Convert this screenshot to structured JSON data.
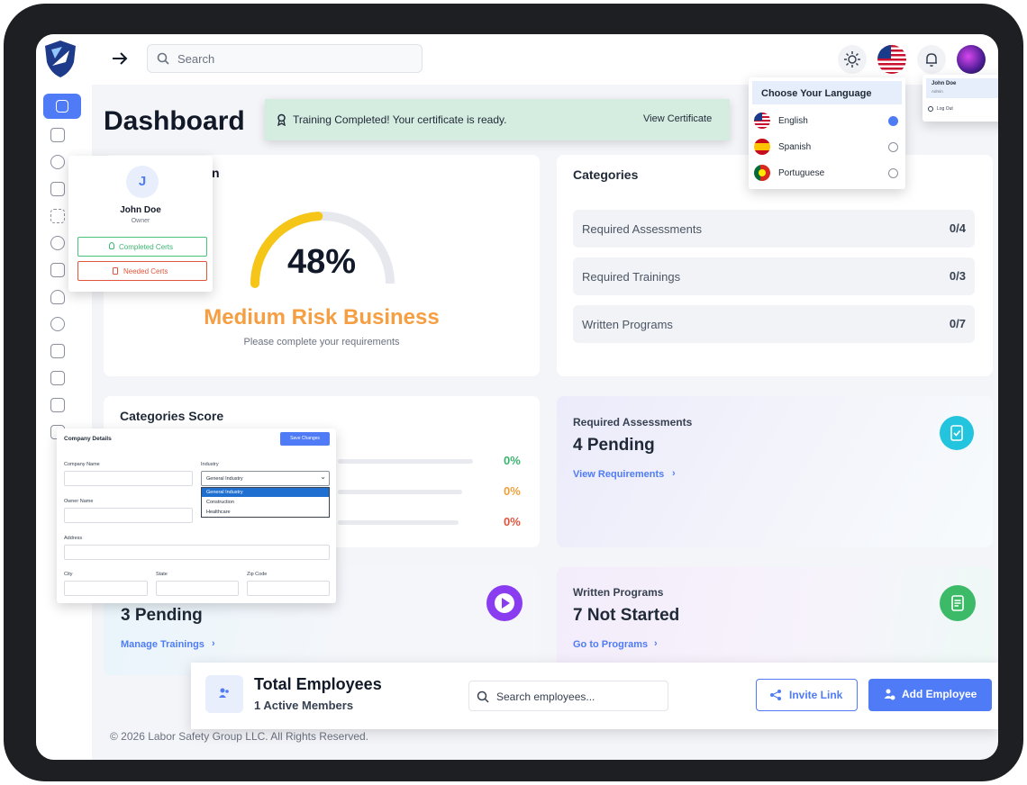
{
  "topbar": {
    "search_placeholder": "Search"
  },
  "page": {
    "title": "Dashboard",
    "footer": "© 2026 Labor Safety Group LLC. All Rights Reserved."
  },
  "toast": {
    "message": "Training Completed! Your certificate is ready.",
    "action": "View Certificate"
  },
  "profile_card": {
    "avatar_initial": "J",
    "name": "John Doe",
    "role": "Owner",
    "completed": "Completed Certs",
    "needed": "Needed Certs",
    "partial_heading": "n"
  },
  "risk": {
    "percent_text": "48%",
    "percent_value": 48,
    "level": "Medium Risk Business",
    "note": "Please complete your requirements"
  },
  "categories": {
    "title": "Categories",
    "rows": [
      {
        "label": "Required Assessments",
        "value": "0/4"
      },
      {
        "label": "Required Trainings",
        "value": "0/3"
      },
      {
        "label": "Written Programs",
        "value": "0/7"
      }
    ]
  },
  "categories_score": {
    "title": "Categories Score",
    "rows": [
      {
        "percent": "0%",
        "color": "#3cb371"
      },
      {
        "percent": "0%",
        "color": "#f0a03c"
      },
      {
        "percent": "0%",
        "color": "#e0553c"
      }
    ]
  },
  "assessments": {
    "label": "Required Assessments",
    "count": "4 Pending",
    "link": "View Requirements",
    "icon_color": "#22c5dd"
  },
  "trainings": {
    "count": "3 Pending",
    "link": "Manage Trainings",
    "icon_color": "#8a3df0"
  },
  "programs": {
    "label": "Written Programs",
    "count": "7 Not Started",
    "link": "Go to Programs",
    "icon_color": "#3cba68"
  },
  "employees": {
    "title": "Total Employees",
    "members": "1 Active Members",
    "search_placeholder": "Search employees...",
    "invite": "Invite Link",
    "add": "Add Employee"
  },
  "language_menu": {
    "title": "Choose Your Language",
    "options": [
      {
        "label": "English",
        "selected": true
      },
      {
        "label": "Spanish",
        "selected": false
      },
      {
        "label": "Portuguese",
        "selected": false
      }
    ]
  },
  "user_menu": {
    "name": "John Doe",
    "role": "Admin",
    "logout": "Log Out"
  },
  "company_form": {
    "title": "Company Details",
    "save": "Save Changes",
    "company_name": "Company Name",
    "industry": "Industry",
    "industry_selected": "General Industry",
    "industry_options": [
      "General Industry",
      "Construction",
      "Healthcare"
    ],
    "owner_name": "Owner Name",
    "address": "Address",
    "city": "City",
    "state": "State",
    "zip": "Zip Code"
  },
  "colors": {
    "accent": "#4f7cf6",
    "risk_orange": "#f59e42",
    "gauge_yellow": "#f5c518",
    "toast_bg": "#d5ece0"
  }
}
